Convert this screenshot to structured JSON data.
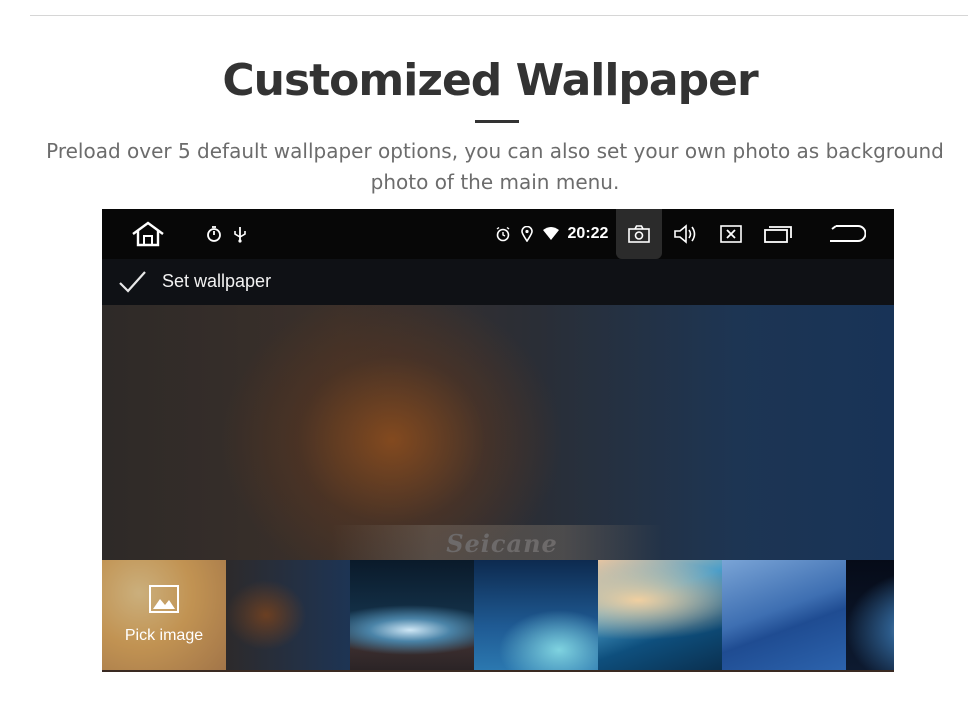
{
  "header": {
    "title": "Customized Wallpaper",
    "subtitle": "Preload over 5 default wallpaper options, you can also set your own photo as background photo of the main menu."
  },
  "statusbar": {
    "time": "20:22",
    "icons": [
      "home-icon",
      "stopwatch-icon",
      "usb-icon",
      "alarm-icon",
      "location-icon",
      "wifi-icon",
      "camera-icon",
      "volume-icon",
      "close-box-icon",
      "recent-apps-icon",
      "back-icon"
    ]
  },
  "action_bar": {
    "label": "Set wallpaper"
  },
  "watermark": "Seicane",
  "thumbnails": {
    "pick_label": "Pick image"
  },
  "colors": {
    "title": "#333333",
    "subtitle": "#6c6c6c",
    "statusbar_bg": "#070707"
  }
}
